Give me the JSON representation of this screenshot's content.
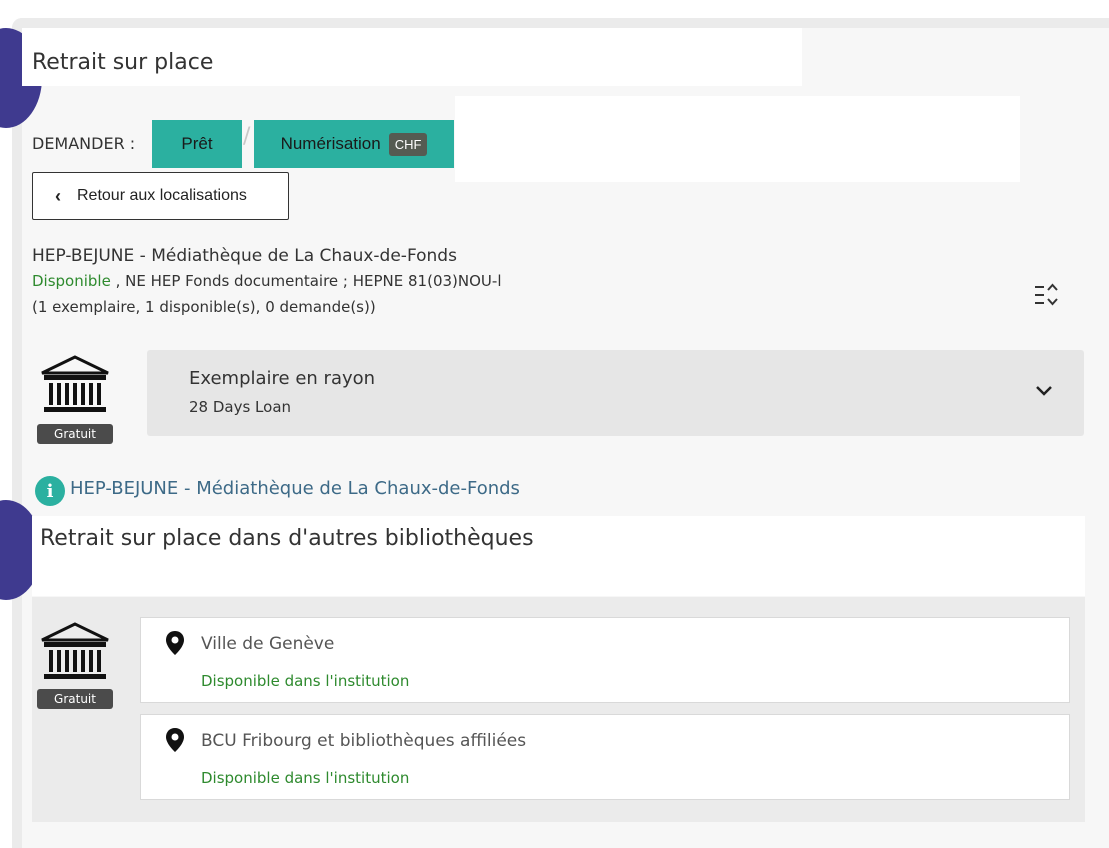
{
  "section1": {
    "title": "Retrait sur place",
    "demander_label": "DEMANDER :",
    "buttons": {
      "pret": "Prêt",
      "numerisation": "Numérisation",
      "chf_badge": "CHF",
      "separator": "/"
    },
    "back_button": "Retour aux localisations"
  },
  "holding": {
    "library": "HEP-BEJUNE - Médiathèque de La Chaux-de-Fonds",
    "status": "Disponible",
    "location": " , NE HEP Fonds documentaire ; HEPNE 81(03)NOU-l",
    "counts": "(1 exemplaire, 1 disponible(s), 0 demande(s))",
    "gratuit": "Gratuit",
    "item_title": "Exemplaire en rayon",
    "item_policy": "28 Days Loan",
    "info_link": "HEP-BEJUNE - Médiathèque de La Chaux-de-Fonds"
  },
  "section2": {
    "title": "Retrait sur place dans d'autres bibliothèques",
    "gratuit": "Gratuit",
    "locations": [
      {
        "name": "Ville de Genève",
        "status": "Disponible dans l'institution"
      },
      {
        "name": "BCU Fribourg et bibliothèques affiliées",
        "status": "Disponible dans l'institution"
      }
    ]
  },
  "colors": {
    "teal": "#2bb0a0",
    "purple": "#3f3a8f",
    "green": "#2e8a2e",
    "link": "#3d6a87"
  }
}
